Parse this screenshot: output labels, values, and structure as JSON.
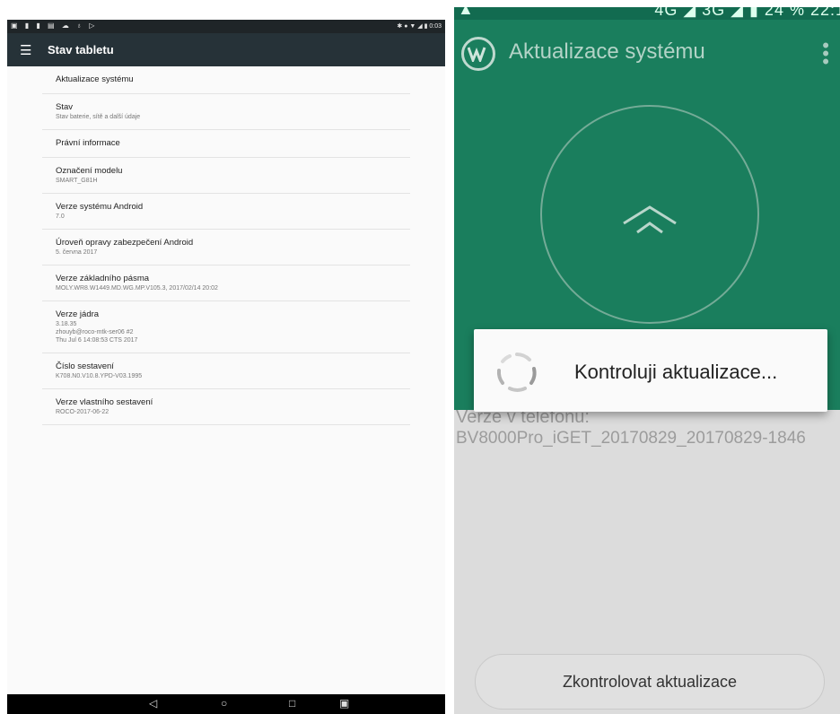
{
  "tablet": {
    "status_right": "0:03",
    "toolbar": {
      "menu_icon": "hamburger-icon",
      "title": "Stav tabletu"
    },
    "items": [
      {
        "title": "Aktualizace systému",
        "subtitle": ""
      },
      {
        "title": "Stav",
        "subtitle": "Stav baterie, sítě a další údaje"
      },
      {
        "title": "Právní informace",
        "subtitle": ""
      },
      {
        "title": "Označení modelu",
        "subtitle": "SMART_G81H"
      },
      {
        "title": "Verze systému Android",
        "subtitle": "7.0"
      },
      {
        "title": "Úroveň opravy zabezpečení Android",
        "subtitle": "5. června 2017"
      },
      {
        "title": "Verze základního pásma",
        "subtitle": "MOLY.WR8.W1449.MD.WG.MP.V105.3, 2017/02/14 20:02"
      },
      {
        "title": "Verze jádra",
        "subtitle": "3.18.35\nzhouyb@roco-mtk-ser06 #2\nThu Jul 6 14:08:53 CTS 2017"
      },
      {
        "title": "Číslo sestavení",
        "subtitle": "K708.N0.V10.8.YPD-V03.1995"
      },
      {
        "title": "Verze vlastního sestavení",
        "subtitle": "ROCO-2017-06-22"
      }
    ],
    "navbar": {
      "back": "◁",
      "home": "○",
      "recents": "□",
      "screenshot": "▣"
    }
  },
  "phone": {
    "status_text": "4G ◢ 3G ◢ ▮ 24 % 22:1",
    "header": {
      "title": "Aktualizace systému",
      "more_icon": "⋮"
    },
    "phone_label": "Verze v telefonu:",
    "phone_value": "BV8000Pro_iGET_20170829_20170829-1846",
    "dialog_message": "Kontroluji aktualizace...",
    "check_button": "Zkontrolovat aktualizace"
  },
  "colors": {
    "tablet_toolbar": "#263238",
    "phone_header": "#1a7e5d"
  }
}
